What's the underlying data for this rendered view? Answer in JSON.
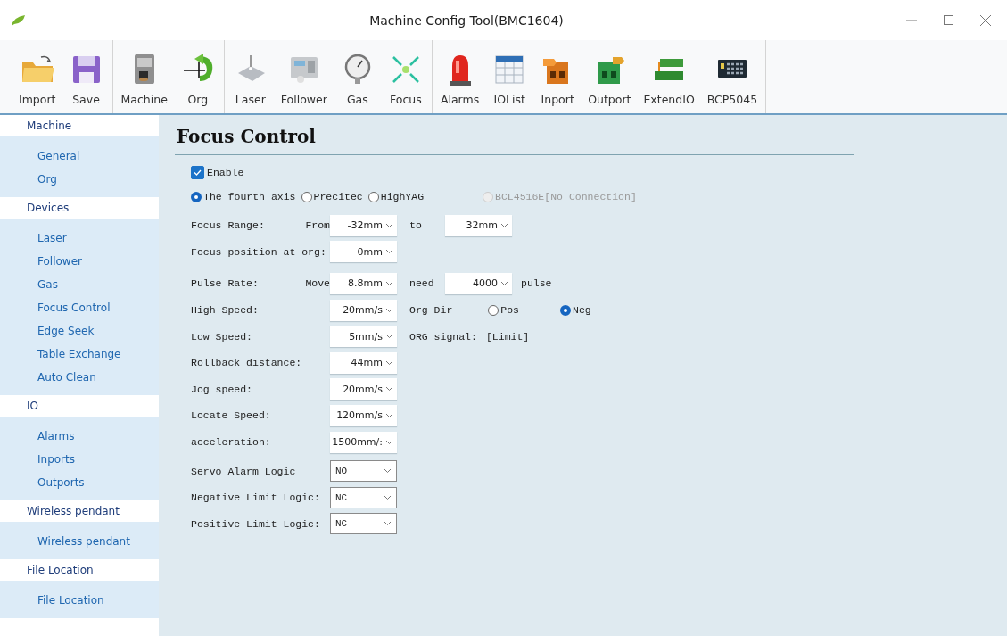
{
  "window": {
    "title": "Machine Config Tool(BMC1604)"
  },
  "toolbar": {
    "groups": [
      {
        "buttons": [
          {
            "label": "Import"
          },
          {
            "label": "Save"
          }
        ]
      },
      {
        "buttons": [
          {
            "label": "Machine"
          },
          {
            "label": "Org"
          }
        ]
      },
      {
        "buttons": [
          {
            "label": "Laser"
          },
          {
            "label": "Follower"
          },
          {
            "label": "Gas"
          },
          {
            "label": "Focus"
          }
        ]
      },
      {
        "buttons": [
          {
            "label": "Alarms"
          },
          {
            "label": "IOList"
          },
          {
            "label": "Inport"
          },
          {
            "label": "Outport"
          },
          {
            "label": "ExtendIO"
          },
          {
            "label": "BCP5045"
          }
        ]
      }
    ]
  },
  "sidebar": {
    "groups": [
      {
        "header": "Machine",
        "items": [
          {
            "label": "General",
            "selected": false
          },
          {
            "label": "Org",
            "selected": false
          }
        ]
      },
      {
        "header": "Devices",
        "items": [
          {
            "label": "Laser",
            "selected": false
          },
          {
            "label": "Follower",
            "selected": false
          },
          {
            "label": "Gas",
            "selected": false
          },
          {
            "label": "Focus Control",
            "selected": false
          },
          {
            "label": "Edge Seek",
            "selected": false
          },
          {
            "label": "Table Exchange",
            "selected": false
          },
          {
            "label": "Auto Clean",
            "selected": false
          }
        ]
      },
      {
        "header": "IO",
        "items": [
          {
            "label": "Alarms",
            "selected": false
          },
          {
            "label": "Inports",
            "selected": false
          },
          {
            "label": "Outports",
            "selected": false
          }
        ]
      },
      {
        "header": "Wireless pendant",
        "items": [
          {
            "label": "Wireless pendant",
            "selected": false
          }
        ]
      },
      {
        "header": "File Location",
        "items": [
          {
            "label": "File Location",
            "selected": false
          }
        ]
      }
    ]
  },
  "panel": {
    "title": "Focus Control",
    "enable": {
      "label": "Enable",
      "checked": true
    },
    "axis_options": [
      {
        "label": "The fourth axis",
        "selected": true,
        "disabled": false
      },
      {
        "label": "Precitec",
        "selected": false,
        "disabled": false
      },
      {
        "label": "HighYAG",
        "selected": false,
        "disabled": false
      },
      {
        "label": "BCL4516E[No Connection]",
        "selected": false,
        "disabled": true
      }
    ],
    "rows": [
      {
        "label": "Focus Range:",
        "prefix": "From",
        "value": "-32mm",
        "kind": "combo",
        "extras": [
          {
            "kind": "text",
            "text": "to"
          },
          {
            "kind": "select",
            "value": "32mm"
          }
        ]
      },
      {
        "label": "Focus position at org:",
        "value": "0mm",
        "kind": "combo"
      },
      {
        "label": "Pulse Rate:",
        "prefix": "Move",
        "value": "8.8mm",
        "kind": "combo",
        "extras": [
          {
            "kind": "text",
            "text": "need"
          },
          {
            "kind": "select",
            "value": "4000"
          },
          {
            "kind": "text",
            "text": "pulse"
          }
        ]
      },
      {
        "label": "High Speed:",
        "value": "20mm/s",
        "kind": "combo",
        "extras": [
          {
            "kind": "text",
            "text": "Org Dir"
          },
          {
            "kind": "radio",
            "label": "Pos",
            "selected": false
          },
          {
            "kind": "radio",
            "label": "Neg",
            "selected": true
          }
        ]
      },
      {
        "label": "Low Speed:",
        "value": "5mm/s",
        "kind": "combo",
        "extras": [
          {
            "kind": "text",
            "text": "ORG signal:"
          },
          {
            "kind": "text",
            "text": "[Limit]"
          }
        ]
      },
      {
        "label": "Rollback distance:",
        "value": "44mm",
        "kind": "combo"
      },
      {
        "label": "Jog speed:",
        "value": "20mm/s",
        "kind": "combo"
      },
      {
        "label": "Locate Speed:",
        "value": "120mm/s",
        "kind": "combo"
      },
      {
        "label": "acceleration:",
        "value": "1500mm/:",
        "kind": "combo"
      },
      {
        "label": "Servo Alarm Logic",
        "value": "NO",
        "kind": "dropdown"
      },
      {
        "label": "Negative Limit Logic:",
        "value": "NC",
        "kind": "dropdown"
      },
      {
        "label": "Positive Limit Logic:",
        "value": "NC",
        "kind": "dropdown"
      }
    ]
  }
}
